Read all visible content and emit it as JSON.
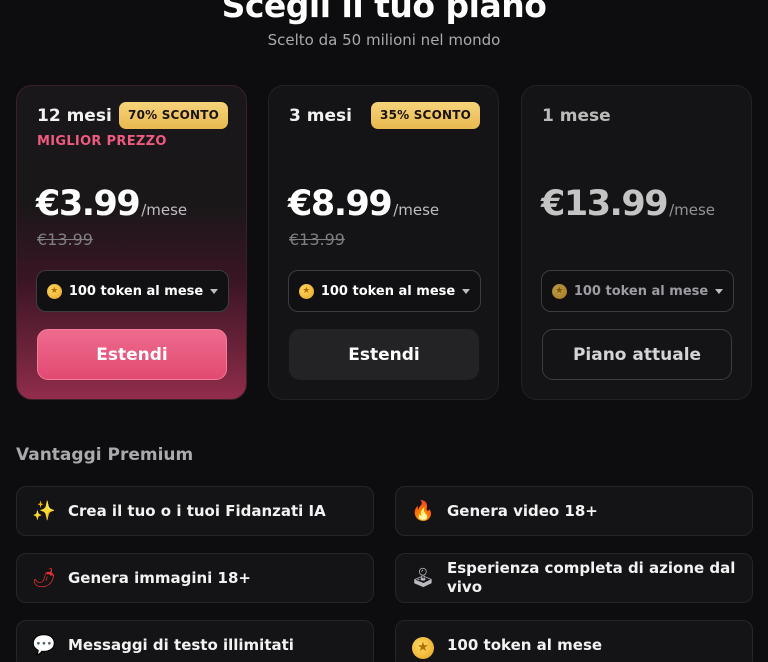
{
  "header": {
    "title": "Scegli il tuo piano",
    "subtitle": "Scelto da 50 milioni nel mondo"
  },
  "plans": [
    {
      "name": "12 mesi",
      "badge": "70% SCONTO",
      "tag": "MIGLIOR PREZZO",
      "price": "€3.99",
      "unit": "/mese",
      "old_price": "€13.99",
      "tokens": "100 token al mese",
      "button": "Estendi"
    },
    {
      "name": "3 mesi",
      "badge": "35% SCONTO",
      "price": "€8.99",
      "unit": "/mese",
      "old_price": "€13.99",
      "tokens": "100 token al mese",
      "button": "Estendi"
    },
    {
      "name": "1 mese",
      "price": "€13.99",
      "unit": "/mese",
      "tokens": "100 token al mese",
      "button": "Piano attuale"
    }
  ],
  "benefits": {
    "title": "Vantaggi Premium",
    "items": [
      {
        "label": "Crea il tuo o i tuoi Fidanzati IA",
        "icon": "sparkle-icon"
      },
      {
        "label": "Genera video 18+",
        "icon": "fire-icon"
      },
      {
        "label": "Genera immagini 18+",
        "icon": "chili-icon"
      },
      {
        "label": "Esperienza completa di azione dal vivo",
        "icon": "joystick-icon"
      },
      {
        "label": "Messaggi di testo illimitati",
        "icon": "chat-bubble-icon"
      },
      {
        "label": "100 token al mese",
        "icon": "coin-icon"
      }
    ]
  },
  "colors": {
    "accent": "#e14a72",
    "badge": "#e8b94f",
    "tag": "#ef5a7f",
    "background": "#0d0d0f"
  }
}
